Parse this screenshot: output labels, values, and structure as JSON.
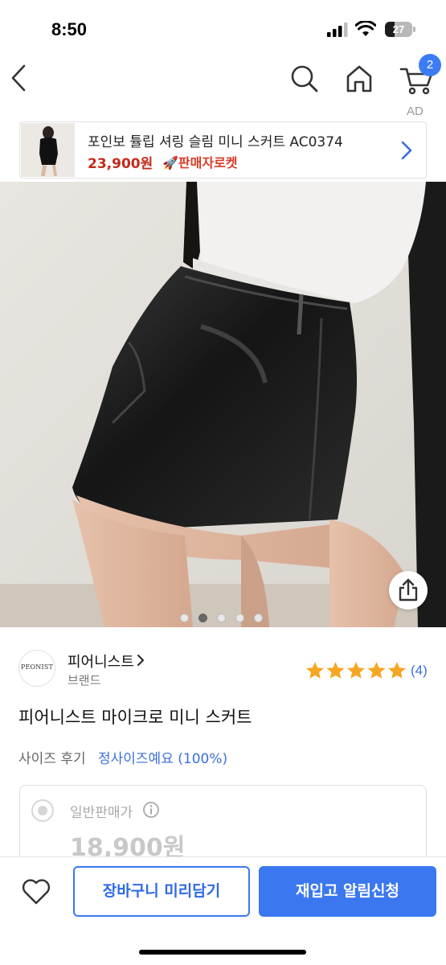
{
  "status_bar": {
    "time": "8:50",
    "battery_level": "27",
    "icons": [
      "cellular-signal-icon",
      "wifi-icon",
      "battery-icon"
    ]
  },
  "nav": {
    "icons": [
      "chevron-left-icon",
      "search-icon",
      "home-icon",
      "cart-icon"
    ],
    "cart_badge": "2"
  },
  "ad": {
    "label": "AD",
    "title": "포인보 튤립 셔링 슬림 미니 스커트 AC0374",
    "price": "23,900원",
    "badge": "🚀판매자로켓"
  },
  "gallery": {
    "dot_count": 5,
    "active_index": 1
  },
  "brand": {
    "logo_text": "PEONIST",
    "name": "피어니스트",
    "type": "브랜드"
  },
  "rating": {
    "stars": 5,
    "review_count": "(4)"
  },
  "product": {
    "title": "피어니스트 마이크로 미니 스커트",
    "size_label": "사이즈 후기",
    "size_value": "정사이즈예요 (100%)"
  },
  "price_card": {
    "type_label": "일반판매가",
    "price": "18,900원"
  },
  "bottom_bar": {
    "cart_button": "장바구니 미리담기",
    "restock_button": "재입고 알림신청"
  },
  "colors": {
    "accent": "#3b78f0",
    "price_red": "#c62a1a",
    "star": "#f5a623"
  }
}
